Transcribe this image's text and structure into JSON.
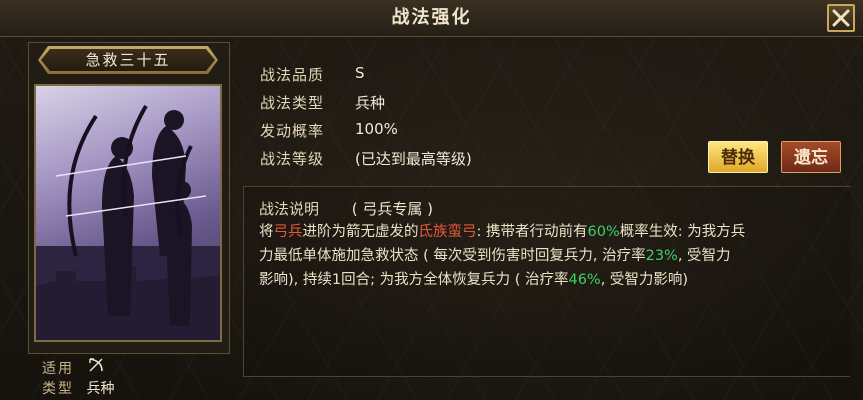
{
  "window": {
    "title": "战法强化"
  },
  "card": {
    "name": "急救三十五",
    "applies_label": "适用",
    "type_label": "类型",
    "type_value": "兵种"
  },
  "info": {
    "quality_label": "战法品质",
    "quality_value": "S",
    "type_label": "战法类型",
    "type_value": "兵种",
    "rate_label": "发动概率",
    "rate_value": "100%",
    "level_label": "战法等级",
    "level_value": "(已达到最高等级)"
  },
  "buttons": {
    "replace": "替换",
    "forget": "遗忘"
  },
  "description": {
    "heading": "战法说明",
    "subheading": "( 弓兵专属 )",
    "line1": {
      "p1": "将",
      "p2": "弓兵",
      "p3": "进阶为箭无虚发的",
      "p4": "氐族蛮弓",
      "p5": ": 携带者行动前有",
      "p6": "60%",
      "p7": "概率生效: 为我方兵"
    },
    "line2": {
      "p1": "力最低单体施加急救状态 ( 每次受到伤害时回复兵力, 治疗率",
      "p2": "23%",
      "p3": ", 受智力"
    },
    "line3": {
      "p1": "影响), 持续1回合; 为我方全体恢复兵力 ( 治疗率",
      "p2": "46%",
      "p3": ", 受智力影响)"
    }
  },
  "colors": {
    "highlight_red": "#e8573a",
    "highlight_green": "#3fcf6a",
    "gold": "#e0a629"
  }
}
